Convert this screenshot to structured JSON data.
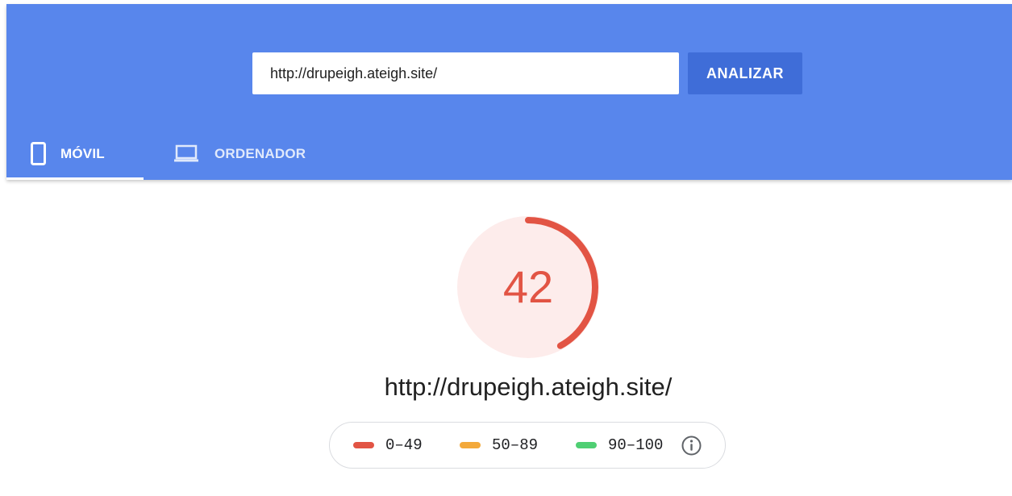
{
  "search": {
    "value": "http://drupeigh.ateigh.site/",
    "button_label": "ANALIZAR"
  },
  "tabs": [
    {
      "label": "MÓVIL",
      "icon": "smartphone-icon",
      "selected": true
    },
    {
      "label": "ORDENADOR",
      "icon": "laptop-icon",
      "selected": false
    }
  ],
  "score": {
    "value": "42",
    "progress": 0.42,
    "color": "#e25444"
  },
  "tested_url": "http://drupeigh.ateigh.site/",
  "legend": [
    {
      "range": "0–49",
      "color": "#e25444"
    },
    {
      "range": "50–89",
      "color": "#f3a93a"
    },
    {
      "range": "90–100",
      "color": "#4fcf73"
    }
  ],
  "icons": {
    "info": "info-icon"
  },
  "colors": {
    "header": "#5886ec",
    "button": "#3f6dd8",
    "gauge_background": "#fdeceb"
  }
}
